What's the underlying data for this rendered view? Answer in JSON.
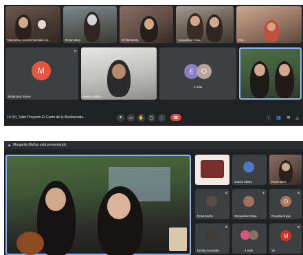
{
  "top": {
    "participants": [
      {
        "name": "Macarena andrea barrales ca..."
      },
      {
        "name": "Rosa Menr"
      },
      {
        "name": "Emilia Marty"
      },
      {
        "name": "Jacqueline Silva"
      },
      {
        "name": "Paz..."
      },
      {
        "name": "Stelamina Torres",
        "initial": "M",
        "color": "#e4573c"
      },
      {
        "name": "Jose's Valdiv..."
      },
      {
        "name": "1 mas",
        "initials": [
          "E",
          "O"
        ],
        "colors": [
          "#8d7eca",
          "#b7a79b"
        ]
      },
      {
        "name": ""
      }
    ],
    "bar": {
      "time": "10:30",
      "title": "Taller Proyecto El Canto de la Biodiversida..."
    }
  },
  "bottom": {
    "banner": "Margarita Muñoz está presentando",
    "sidebar": [
      {
        "name": ""
      },
      {
        "name": "Gonzo Marty"
      },
      {
        "name": "Rosa Menr"
      },
      {
        "name": "Rosa Muño"
      },
      {
        "name": "Jacqueline Silva"
      },
      {
        "name": "Claudia Araya",
        "initial": "O",
        "color": "#b07858"
      },
      {
        "name": "Emilia Gonzalez"
      },
      {
        "name": "4 más"
      },
      {
        "name": "Yo",
        "initial": "M",
        "color": "#d93025"
      }
    ]
  },
  "icons": {
    "mic": "mic-icon",
    "camera": "camera-icon",
    "hand": "raise-hand-icon",
    "present": "present-icon",
    "more": "more-icon",
    "end": "end-call-icon",
    "info": "info-icon",
    "people": "people-icon",
    "chat": "chat-icon",
    "activities": "activities-icon"
  }
}
